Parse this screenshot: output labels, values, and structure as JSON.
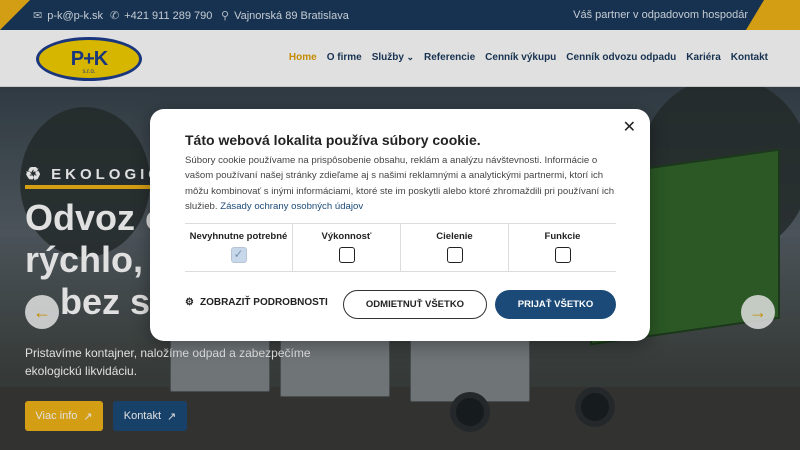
{
  "topbar": {
    "email": "p-k@p-k.sk",
    "phone": "+421 911 289 790",
    "address": "Vajnorská 89 Bratislava",
    "partner": "Váš partner v odpadovom hospodár",
    "email_icon": "mail-icon",
    "phone_icon": "phone-icon",
    "address_icon": "location-pin-icon"
  },
  "logo": {
    "text": "P+K",
    "subtext": "s.r.o."
  },
  "nav": {
    "items": [
      {
        "label": "Home",
        "active": true
      },
      {
        "label": "O firme"
      },
      {
        "label": "Služby",
        "dropdown": true
      },
      {
        "label": "Referencie"
      },
      {
        "label": "Cenník výkupu"
      },
      {
        "label": "Cenník odvozu odpadu"
      },
      {
        "label": "Kariéra"
      },
      {
        "label": "Kontakt"
      }
    ]
  },
  "hero": {
    "tag": "EKOLOGIC",
    "title_line1": "Odvoz odpadu",
    "title_line2": "rýchlo, spoľahlivo",
    "title_line3": "bez starostí",
    "subtitle": "Pristavíme kontajner, naložíme odpad a zabezpečíme ekologickú likvidáciu.",
    "btn_info": "Viac info",
    "btn_contact": "Kontakt",
    "arrow_icon": "arrow-right-icon"
  },
  "cookie_modal": {
    "title": "Táto webová lokalita používa súbory cookie.",
    "description": "Súbory cookie používame na prispôsobenie obsahu, reklám a analýzu návštevnosti. Informácie o vašom používaní našej stránky zdieľame aj s našimi reklamnými a analytickými partnermi, ktorí ich môžu kombinovať s inými informáciami, ktoré ste im poskytli alebo ktoré zhromaždili pri používaní ich služieb.",
    "privacy_link": "Zásady ochrany osobných údajov",
    "categories": [
      {
        "label": "Nevyhnutne potrebné",
        "checked": true,
        "disabled": true
      },
      {
        "label": "Výkonnosť",
        "checked": false
      },
      {
        "label": "Cielenie",
        "checked": false
      },
      {
        "label": "Funkcie",
        "checked": false
      }
    ],
    "show_details": "ZOBRAZIŤ PODROBNOSTI",
    "reject_all": "ODMIETNUŤ VŠETKO",
    "accept_all": "PRIJAŤ VŠETKO",
    "close_icon": "close-icon"
  }
}
